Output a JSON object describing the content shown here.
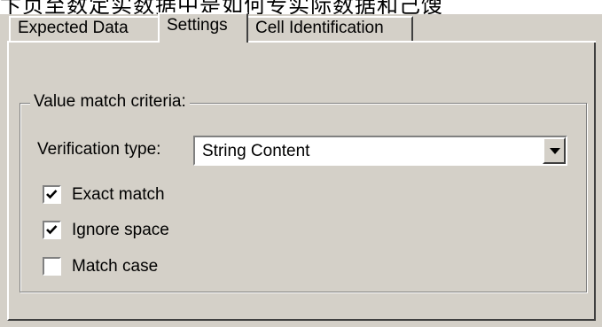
{
  "header_fragment": "卞页至数定实数据中是如何专实际数据和己馊",
  "tabs": [
    {
      "label": "Expected Data",
      "active": false
    },
    {
      "label": "Settings",
      "active": true
    },
    {
      "label": "Cell Identification",
      "active": false
    }
  ],
  "group": {
    "legend": "Value match criteria:",
    "verification": {
      "label": "Verification type:",
      "selected": "String Content"
    },
    "checkboxes": [
      {
        "label": "Exact match",
        "checked": true
      },
      {
        "label": "Ignore space",
        "checked": true
      },
      {
        "label": "Match case",
        "checked": false
      }
    ]
  },
  "colors": {
    "face": "#d4d0c8",
    "highlight": "#ffffff",
    "shadow": "#808080",
    "dark_shadow": "#404040"
  }
}
